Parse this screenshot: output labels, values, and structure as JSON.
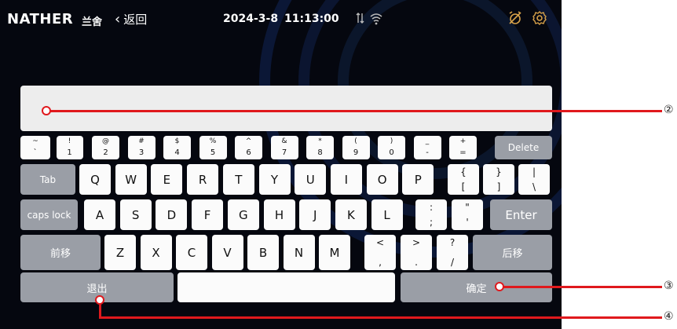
{
  "header": {
    "brand": "NATHER",
    "brand_cn": "兰舍",
    "back_label": "返回",
    "date": "2024-3-8",
    "time": "11:13:00"
  },
  "keyboard": {
    "number_row": [
      {
        "top": "~",
        "bottom": "`"
      },
      {
        "top": "!",
        "bottom": "1"
      },
      {
        "top": "@",
        "bottom": "2"
      },
      {
        "top": "#",
        "bottom": "3"
      },
      {
        "top": "$",
        "bottom": "4"
      },
      {
        "top": "%",
        "bottom": "5"
      },
      {
        "top": "^",
        "bottom": "6"
      },
      {
        "top": "&",
        "bottom": "7"
      },
      {
        "top": "*",
        "bottom": "8"
      },
      {
        "top": "(",
        "bottom": "9"
      },
      {
        "top": ")",
        "bottom": "0"
      },
      {
        "top": "_",
        "bottom": "-"
      },
      {
        "top": "+",
        "bottom": "="
      }
    ],
    "delete": "Delete",
    "tab": "Tab",
    "row_q": [
      "Q",
      "W",
      "E",
      "R",
      "T",
      "Y",
      "U",
      "I",
      "O",
      "P"
    ],
    "row_q_sym": [
      {
        "top": "{",
        "bottom": "["
      },
      {
        "top": "}",
        "bottom": "]"
      },
      {
        "top": "|",
        "bottom": "\\"
      }
    ],
    "caps": "caps lock",
    "row_a": [
      "A",
      "S",
      "D",
      "F",
      "G",
      "H",
      "J",
      "K",
      "L"
    ],
    "row_a_sym": [
      {
        "top": ":",
        "bottom": ";"
      },
      {
        "top": "\"",
        "bottom": "'"
      }
    ],
    "enter": "Enter",
    "prev": "前移",
    "row_z": [
      "Z",
      "X",
      "C",
      "V",
      "B",
      "N",
      "M"
    ],
    "row_z_sym": [
      {
        "top": "<",
        "bottom": ","
      },
      {
        "top": ">",
        "bottom": "."
      },
      {
        "top": "?",
        "bottom": "/"
      }
    ],
    "next": "后移",
    "exit": "退出",
    "confirm": "确定"
  },
  "callouts": [
    "②",
    "③",
    "④"
  ],
  "colors": {
    "accent_red": "#e0191d",
    "key_dark": "#9a9ea6",
    "screen_bg": "#05070f"
  }
}
